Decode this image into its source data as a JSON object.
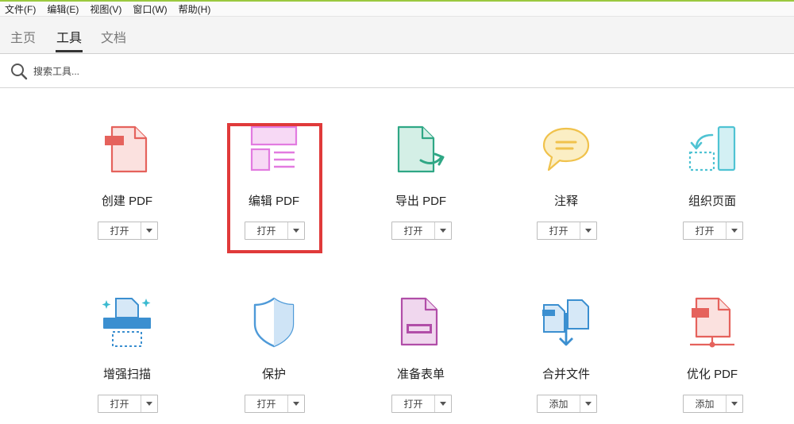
{
  "menubar": {
    "items": [
      "文件(F)",
      "编辑(E)",
      "视图(V)",
      "窗口(W)",
      "帮助(H)"
    ]
  },
  "tabs": [
    {
      "label": "主页",
      "active": false
    },
    {
      "label": "工具",
      "active": true
    },
    {
      "label": "文档",
      "active": false
    }
  ],
  "search": {
    "placeholder": "搜索工具..."
  },
  "colors": {
    "highlight": "#e03a3a",
    "accent_bar": "#9bc93f"
  },
  "tools": [
    {
      "name": "create-pdf",
      "label": "创建 PDF",
      "button": "打开",
      "icon": "create-pdf-icon",
      "color": "#e5625c"
    },
    {
      "name": "edit-pdf",
      "label": "编辑 PDF",
      "button": "打开",
      "icon": "edit-pdf-icon",
      "color": "#e27be0",
      "highlighted": true
    },
    {
      "name": "export-pdf",
      "label": "导出 PDF",
      "button": "打开",
      "icon": "export-pdf-icon",
      "color": "#2fa785"
    },
    {
      "name": "comment",
      "label": "注释",
      "button": "打开",
      "icon": "comment-icon",
      "color": "#f0c24c"
    },
    {
      "name": "organize-pages",
      "label": "组织页面",
      "button": "打开",
      "icon": "organize-pages-icon",
      "color": "#4fc3d3"
    },
    {
      "name": "enhance-scans",
      "label": "增强扫描",
      "button": "打开",
      "icon": "enhance-scans-icon",
      "color": "#3b8fd0"
    },
    {
      "name": "protect",
      "label": "保护",
      "button": "打开",
      "icon": "protect-icon",
      "color": "#4e9ad8"
    },
    {
      "name": "prepare-form",
      "label": "准备表单",
      "button": "打开",
      "icon": "prepare-form-icon",
      "color": "#b14ea8"
    },
    {
      "name": "combine-files",
      "label": "合并文件",
      "button": "添加",
      "icon": "combine-files-icon",
      "color": "#3b8fd0"
    },
    {
      "name": "optimize-pdf",
      "label": "优化 PDF",
      "button": "添加",
      "icon": "optimize-pdf-icon",
      "color": "#e5625c"
    }
  ]
}
